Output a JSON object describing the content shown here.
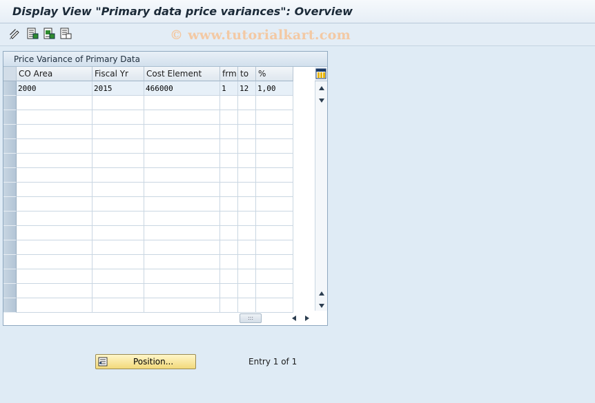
{
  "window": {
    "title": "Display View \"Primary data price variances\": Overview"
  },
  "toolbar": {
    "buttons": [
      {
        "icon": "display-change-icon"
      },
      {
        "icon": "select-all-icon"
      },
      {
        "icon": "select-block-icon"
      },
      {
        "icon": "deselect-all-icon"
      }
    ],
    "watermark": "© www.tutorialkart.com"
  },
  "table": {
    "title": "Price Variance of Primary Data",
    "columns": [
      "CO Area",
      "Fiscal Yr",
      "Cost Element",
      "frm",
      "to",
      "%"
    ],
    "rows": [
      [
        "2000",
        "2015",
        "466000",
        "1",
        "12",
        "1,00"
      ]
    ]
  },
  "footer": {
    "position_button": "Position...",
    "entry_text": "Entry 1 of 1"
  },
  "colors": {
    "background": "#dfebf5",
    "selected_row": "#e7f0f8",
    "button": "#f2d97a"
  }
}
